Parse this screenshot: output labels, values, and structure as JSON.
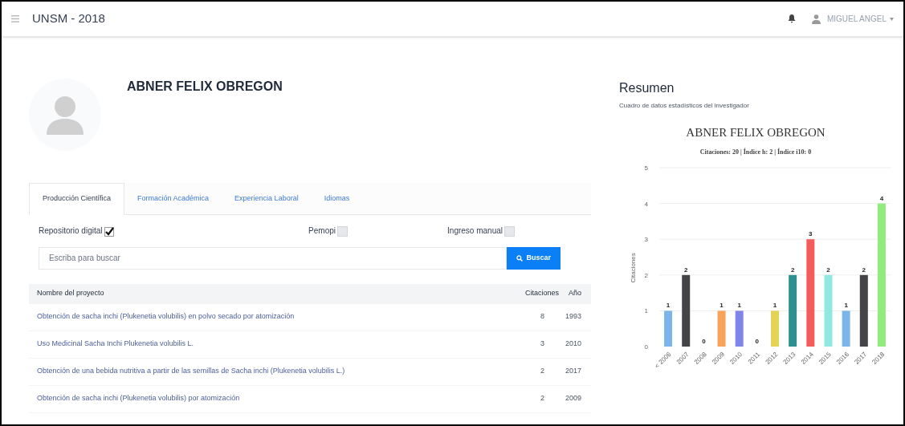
{
  "header": {
    "title": "UNSM - 2018",
    "user": "MIGUEL ANGEL"
  },
  "profile": {
    "name": "ABNER FELIX OBREGON"
  },
  "tabs": [
    {
      "label": "Producción Científica",
      "selected": true
    },
    {
      "label": "Formación Académica",
      "selected": false
    },
    {
      "label": "Experiencia Laboral",
      "selected": false
    },
    {
      "label": "Idiomas",
      "selected": false
    }
  ],
  "filters": [
    {
      "label": "Repositorio digital",
      "checked": true
    },
    {
      "label": "Pemopi",
      "checked": false
    },
    {
      "label": "Ingreso manual",
      "checked": false
    }
  ],
  "search": {
    "placeholder": "Escriba para buscar",
    "button": "Buscar"
  },
  "table": {
    "columns": [
      "Nombre del proyecto",
      "Citaciones",
      "Año"
    ],
    "rows": [
      [
        "Obtención de sacha inchi (Plukenetia volubilis) en polvo secado por atomización",
        "8",
        "1993"
      ],
      [
        "Uso Medicinal Sacha Inchi Plukenetia volubilis L.",
        "3",
        "2010"
      ],
      [
        "Obtención de una bebida nutritiva a partir de las semillas de Sacha inchi (Plukenetia volubilis L.)",
        "2",
        "2017"
      ],
      [
        "Obtención de sacha inchi (Plukenetia volubilis) por atomización",
        "2",
        "2009"
      ]
    ]
  },
  "summary": {
    "title": "Resumen",
    "subtitle": "Cuadro de datos estadísticos del investigador",
    "chart_data": {
      "type": "bar",
      "title": "ABNER FELIX OBREGON",
      "subtitle": "Citaciones: 20 | Índice h: 2 | Índice i10: 0",
      "ylabel": "Citaciones",
      "categories": [
        "< 2006",
        "2007",
        "2008",
        "2009",
        "2010",
        "2011",
        "2012",
        "2013",
        "2014",
        "2015",
        "2016",
        "2017",
        "2018"
      ],
      "series": [
        {
          "colors": [
            "#7cb5ec",
            "#434348",
            "#90ed7d",
            "#f7a35c",
            "#8085e9",
            "#f15c80",
            "#e4d354",
            "#2b908f",
            "#f45b5b",
            "#91e8e1",
            "#7cb5ec",
            "#434348",
            "#90ed7d"
          ],
          "values": [
            1,
            2,
            0,
            1,
            1,
            0,
            1,
            2,
            3,
            2,
            1,
            2,
            4
          ]
        }
      ],
      "ylim": [
        0,
        5
      ],
      "yticks": [
        0,
        1,
        2,
        3,
        4,
        5
      ],
      "grid": true,
      "data_labels": true
    }
  }
}
